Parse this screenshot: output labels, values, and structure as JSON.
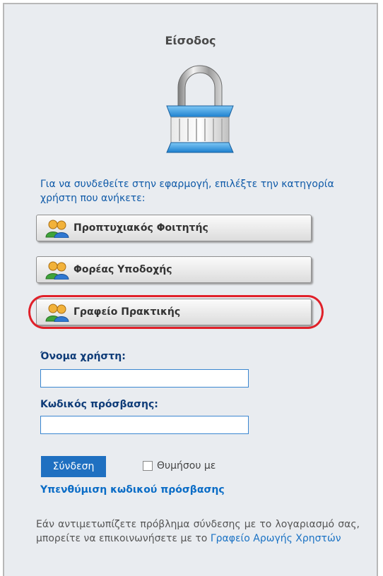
{
  "login": {
    "title": "Είσοδος",
    "intro": "Για να συνδεθείτε στην εφαρμογή, επιλέξτε την κατηγορία χρήστη που ανήκετε:",
    "roles": [
      {
        "label": "Προπτυχιακός Φοιτητής",
        "icon": "users-icon"
      },
      {
        "label": "Φορέας Υποδοχής",
        "icon": "users-icon"
      },
      {
        "label": "Γραφείο Πρακτικής",
        "icon": "users-icon",
        "highlighted": true
      }
    ],
    "highlight_color": "#e0212a",
    "username_label": "Όνομα χρήστη:",
    "username_value": "",
    "password_label": "Κωδικός πρόσβασης:",
    "password_value": "",
    "submit_label": "Σύνδεση",
    "remember_label": "Θυμήσου με",
    "remember_checked": false,
    "forgot_link": "Υπενθύμιση κωδικού πρόσβασης",
    "help_text": "Εάν αντιμετωπίζετε πρόβλημα σύνδεσης με το λογαριασμό σας, μπορείτε να επικοινωνήσετε με το",
    "help_link": "Γραφείο Αρωγής Χρηστών"
  },
  "colors": {
    "accent": "#1f70c1",
    "link": "#0a6cc6",
    "panel_bg": "#e9ecf0"
  }
}
